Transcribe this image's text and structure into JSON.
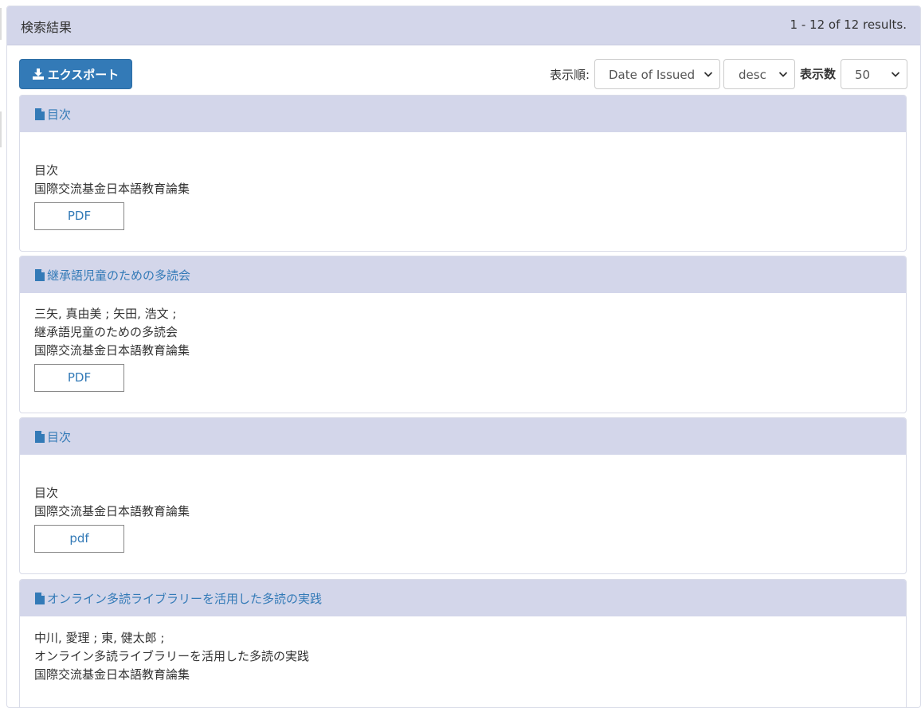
{
  "panel": {
    "title": "検索結果",
    "results_count": "1 - 12 of 12 results."
  },
  "toolbar": {
    "export_label": "エクスポート",
    "sort_label": "表示順:",
    "sort_value": "Date of Issued",
    "order_value": "desc",
    "count_label": "表示数",
    "count_value": "50"
  },
  "results": [
    {
      "title": "目次",
      "authors": "",
      "item_title": "目次",
      "journal": "国際交流基金日本語教育論集",
      "file_label": "PDF"
    },
    {
      "title": "継承語児童のための多読会",
      "authors": "三矢, 真由美 ; 矢田, 浩文 ;",
      "item_title": "継承語児童のための多読会",
      "journal": "国際交流基金日本語教育論集",
      "file_label": "PDF"
    },
    {
      "title": "目次",
      "authors": "",
      "item_title": "目次",
      "journal": "国際交流基金日本語教育論集",
      "file_label": "pdf"
    },
    {
      "title": "オンライン多読ライブラリーを活用した多読の実践",
      "authors": "中川, 愛理 ; 東, 健太郎 ;",
      "item_title": "オンライン多読ライブラリーを活用した多読の実践",
      "journal": "国際交流基金日本語教育論集",
      "file_label": ""
    }
  ],
  "colors": {
    "heading_bg": "#d3d6ea",
    "link": "#337ab7",
    "primary_button": "#337ab7"
  }
}
